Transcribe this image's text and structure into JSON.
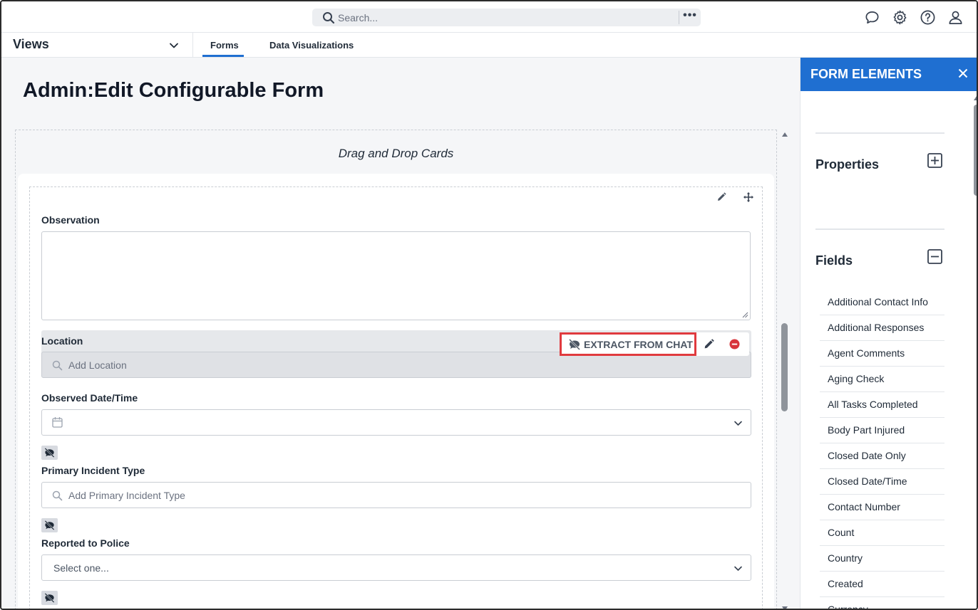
{
  "header": {
    "search_placeholder": "Search...",
    "search_more": "•••",
    "icons": [
      "chat-icon",
      "settings-gear-icon",
      "help-icon",
      "user-icon"
    ]
  },
  "nav": {
    "views_label": "Views",
    "tabs": [
      {
        "label": "Forms",
        "active": true
      },
      {
        "label": "Data Visualizations",
        "active": false
      }
    ]
  },
  "page": {
    "title": "Admin",
    "title_separator": ":",
    "subtitle": "Edit Configurable Form",
    "drag_drop_text": "Drag and Drop Cards"
  },
  "form": {
    "observation_label": "Observation",
    "location_label": "Location",
    "location_placeholder": "Add Location",
    "extract_label": "EXTRACT FROM CHAT",
    "observed_datetime_label": "Observed Date/Time",
    "primary_incident_label": "Primary Incident Type",
    "primary_incident_placeholder": "Add Primary Incident Type",
    "reported_police_label": "Reported to Police",
    "reported_police_value": "Select one..."
  },
  "panel": {
    "title": "FORM ELEMENTS",
    "properties_label": "Properties",
    "fields_label": "Fields",
    "fields": [
      "Additional Contact Info",
      "Additional Responses",
      "Agent Comments",
      "Aging Check",
      "All Tasks Completed",
      "Body Part Injured",
      "Closed Date Only",
      "Closed Date/Time",
      "Contact Number",
      "Count",
      "Country",
      "Created",
      "Currency"
    ]
  },
  "colors": {
    "accent": "#1f6fd1",
    "highlight": "#e03a3e",
    "remove": "#d8333a",
    "background": "#f5f6f8"
  }
}
